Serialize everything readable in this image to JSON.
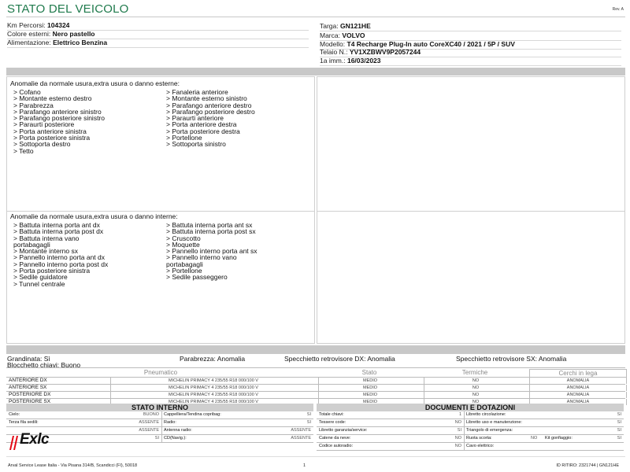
{
  "header": {
    "title": "STATO DEL VEICOLO",
    "rev": "Rev. A"
  },
  "vehicle": {
    "km_label": "Km Percorsi:",
    "km": "104324",
    "color_label": "Colore esterni:",
    "color": "Nero pastello",
    "fuel_label": "Alimentazione:",
    "fuel": "Elettrico Benzina",
    "plate_label": "Targa:",
    "plate": "GN121HE",
    "brand_label": "Marca:",
    "brand": "VOLVO",
    "model_label": "Modello:",
    "model": "T4 Recharge Plug-In auto CoreXC40 / 2021 / 5P / SUV",
    "vin_label": "Telaio N.:",
    "vin": "YV1XZBWV9P2057244",
    "reg_label": "1a imm.:",
    "reg": "16/03/2023"
  },
  "external": {
    "heading": "Anomalie da normale usura,extra usura o danno esterne:",
    "col1": [
      "> Cofano",
      "> Montante esterno destro",
      "> Parabrezza",
      "> Parafango anteriore sinistro",
      "> Parafango posteriore sinistro",
      "> Paraurti posteriore",
      "> Porta anteriore sinistra",
      "> Porta posteriore sinistra",
      "> Sottoporta destro",
      "> Tetto"
    ],
    "col2": [
      "> Fanaleria anteriore",
      "> Montante esterno sinistro",
      "> Parafango anteriore destro",
      "> Parafango posteriore destro",
      "> Paraurti anteriore",
      "> Porta anteriore destra",
      "> Porta posteriore destra",
      "> Portellone",
      "> Sottoporta sinistro"
    ]
  },
  "internal": {
    "heading": "Anomalie da normale usura,extra usura o danno interne:",
    "col1": [
      "> Battuta interna porta ant dx",
      "> Battuta interna porta post dx",
      "> Battuta interna vano",
      "portabagagli",
      "> Montante interno sx",
      "> Pannello interno porta ant dx",
      "> Pannello interno porta post dx",
      "> Porta posteriore sinistra",
      "> Sedile guidatore",
      "> Tunnel centrale"
    ],
    "col2": [
      "> Battuta interna porta ant sx",
      "> Battuta interna porta post sx",
      "> Cruscotto",
      "> Moquette",
      "> Pannello interno porta ant sx",
      "> Pannello interno vano",
      "portabagagli",
      "> Portellone",
      "> Sedile passeggero"
    ]
  },
  "misc": {
    "hail": "Grandinata: Sì",
    "windshield": "Parabrezza: Anomalia",
    "mirror_dx": "Specchietto retrovisore DX: Anomalia",
    "mirror_sx": "Specchietto retrovisore SX: Anomalia",
    "key_lock": "Blocchetto chiavi: Buono"
  },
  "tyres": {
    "headers": {
      "tyre": "Pneumatico",
      "state": "Stato",
      "winter": "Termiche",
      "rims": "Cerchi in lega"
    },
    "rows": [
      {
        "pos": "ANTERIORE DX",
        "model": "MICHELIN PRIMACY 4 235/55 R18 000/100 V",
        "state": "MEDIO",
        "winter": "NO",
        "rim": "ANOMALIA"
      },
      {
        "pos": "ANTERIORE SX",
        "model": "MICHELIN PRIMACY 4 235/55 R18 000/100 V",
        "state": "MEDIO",
        "winter": "NO",
        "rim": "ANOMALIA"
      },
      {
        "pos": "POSTERIORE DX",
        "model": "MICHELIN PRIMACY 4 235/55 R18 000/100 V",
        "state": "MEDIO",
        "winter": "NO",
        "rim": "ANOMALIA"
      },
      {
        "pos": "POSTERIORE SX",
        "model": "MICHELIN PRIMACY 4 235/55 R18 000/100 V",
        "state": "MEDIO",
        "winter": "NO",
        "rim": "ANOMALIA"
      }
    ]
  },
  "interior_state": {
    "heading": "STATO INTERNO",
    "rows": [
      {
        "a_label": "Cielo:",
        "a_val": "BUONO",
        "b_label": "Cappelliera/Tendina copribag:",
        "b_val": "SI"
      },
      {
        "a_label": "Terza fila sedili:",
        "a_val": "ASSENTE",
        "b_label": "Radio:",
        "b_val": "SI"
      },
      {
        "a_label": "",
        "a_val": "ASSENTE",
        "b_label": "Antenna radio:",
        "b_val": "ASSENTE"
      },
      {
        "a_label": "",
        "a_val": "SI",
        "b_label": "CD(Navig.):",
        "b_val": "ASSENTE"
      }
    ]
  },
  "documents": {
    "heading": "DOCUMENTI E DOTAZIONI",
    "rows": [
      {
        "a_label": "Totale chiavi:",
        "a_val": "1",
        "b_label": "Libretto circolazione:",
        "b_val": "SI"
      },
      {
        "a_label": "Tessere code:",
        "a_val": "NO",
        "b_label": "Libretto uso e manutenzione:",
        "b_val": "SI"
      },
      {
        "a_label": "Libretto garanzia/service:",
        "a_val": "SI",
        "b_label": "Triangolo di emergenza:",
        "b_val": "SI"
      },
      {
        "a_label": "Catene da neve:",
        "a_val": "NO",
        "b_label": "Ruota scorta:",
        "b_mid": "NO",
        "b_extra": "Kit gonfiaggio:",
        "b_val": "SI"
      },
      {
        "a_label": "Codice autoradio:",
        "a_val": "NO",
        "b_label": "Cavo elettrico:",
        "b_val": ""
      }
    ]
  },
  "logo": {
    "text": "Exlc"
  },
  "footer": {
    "address": "Arval Service Lease Italia - Via Pisana 314/B, Scandicci (FI), 50018",
    "page": "1",
    "id": "ID RITIRO: 2321744 | GN121HE"
  }
}
